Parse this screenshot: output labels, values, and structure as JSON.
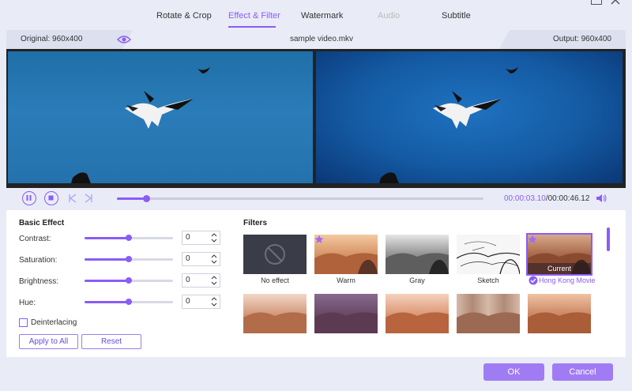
{
  "tabs": [
    {
      "label": "Rotate & Crop"
    },
    {
      "label": "Effect & Filter"
    },
    {
      "label": "Watermark"
    },
    {
      "label": "Audio"
    },
    {
      "label": "Subtitle"
    }
  ],
  "info": {
    "original": "Original: 960x400",
    "filename": "sample video.mkv",
    "output": "Output: 960x400"
  },
  "player": {
    "current_time": "00:00:03.10",
    "total_time": "/00:00:46.12",
    "progress": 0.08
  },
  "basic_effect": {
    "title": "Basic Effect",
    "adjustments": [
      {
        "label": "Contrast:",
        "value": "0",
        "level": 0.5
      },
      {
        "label": "Saturation:",
        "value": "0",
        "level": 0.5
      },
      {
        "label": "Brightness:",
        "value": "0",
        "level": 0.5
      },
      {
        "label": "Hue:",
        "value": "0",
        "level": 0.5
      }
    ],
    "deinterlacing_label": "Deinterlacing",
    "apply_label": "Apply to All",
    "reset_label": "Reset"
  },
  "filters": {
    "title": "Filters",
    "current_badge": "Current",
    "items": [
      {
        "label": "No effect"
      },
      {
        "label": "Warm"
      },
      {
        "label": "Gray"
      },
      {
        "label": "Sketch"
      },
      {
        "label": "Hong Kong Movie"
      },
      {
        "label": ""
      },
      {
        "label": ""
      },
      {
        "label": ""
      },
      {
        "label": ""
      },
      {
        "label": ""
      }
    ]
  },
  "footer": {
    "ok_label": "OK",
    "cancel_label": "Cancel"
  },
  "colors": {
    "accent": "#8b5cf6",
    "button": "#a07cf4"
  }
}
